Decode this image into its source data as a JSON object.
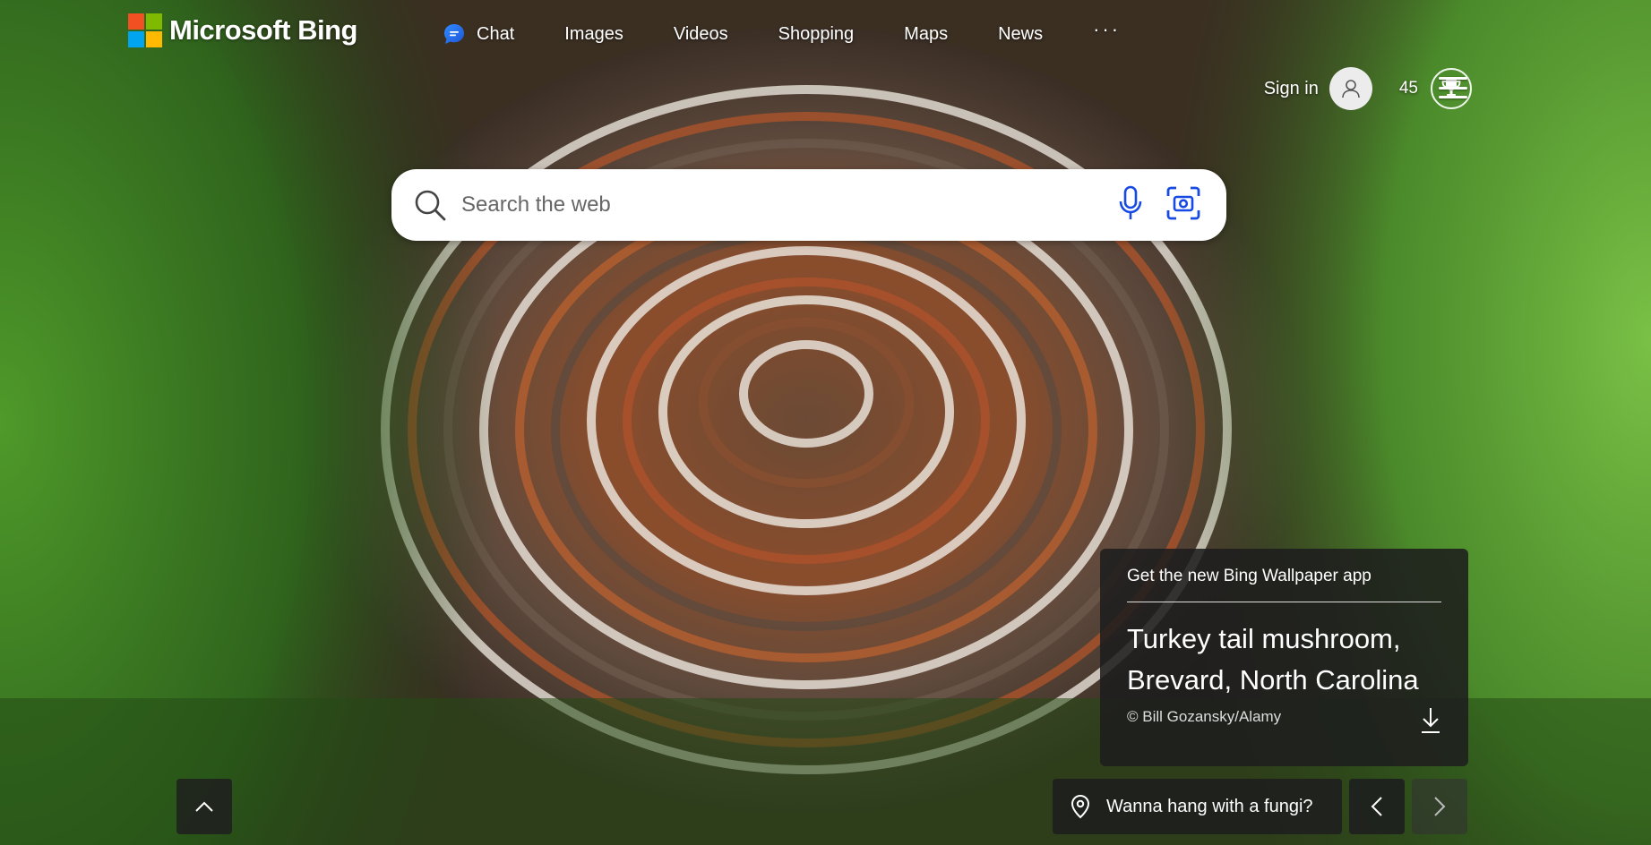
{
  "brand": {
    "name": "Microsoft Bing",
    "colors": [
      "#f25022",
      "#7fba00",
      "#00a4ef",
      "#ffb900"
    ]
  },
  "nav": {
    "items": [
      {
        "label": "Chat",
        "icon": "chat-icon"
      },
      {
        "label": "Images"
      },
      {
        "label": "Videos"
      },
      {
        "label": "Shopping"
      },
      {
        "label": "Maps"
      },
      {
        "label": "News"
      }
    ],
    "more": "···"
  },
  "account": {
    "signin_label": "Sign in",
    "points": "45"
  },
  "search": {
    "placeholder": "Search the web"
  },
  "wallpaper": {
    "app_promo": "Get the new Bing Wallpaper app",
    "title": "Turkey tail mushroom, Brevard, North Carolina",
    "credit": "© Bill Gozansky/Alamy"
  },
  "fact": {
    "text": "Wanna hang with a fungi?"
  },
  "colors": {
    "accent": "#174ae4",
    "card_bg": "#1e1e1e"
  }
}
